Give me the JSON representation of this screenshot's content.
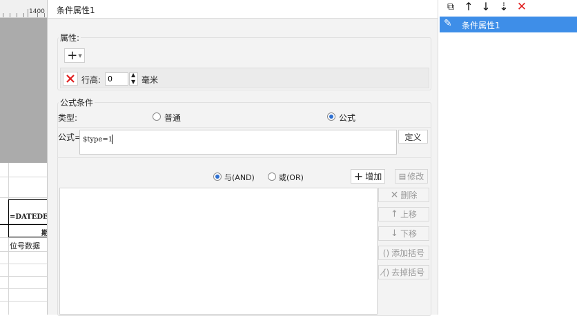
{
  "sheet": {
    "ruler_label": "1400",
    "cells": {
      "formula_cell": "=DATEDEI",
      "cell_2": "期",
      "cell_3": "位号数据"
    }
  },
  "dialog": {
    "title": "条件属性1",
    "properties": {
      "group_label": "属性:",
      "row_height_label": "行高:",
      "row_height_value": "0",
      "unit": "毫米"
    },
    "formula_condition": {
      "group_label": "公式条件",
      "type_label": "类型:",
      "type_options": [
        "普通",
        "公式"
      ],
      "selected_type": "公式",
      "formula_label": "公式=",
      "formula_value": "$type=1",
      "define_button": "定义",
      "logic_options": [
        "与(AND)",
        "或(OR)"
      ],
      "selected_logic": "与(AND)",
      "add_button": "增加",
      "modify_button": "修改",
      "side_buttons": {
        "delete": "删除",
        "move_up": "上移",
        "move_down": "下移",
        "add_bracket": "添加括号",
        "remove_bracket": "去掉括号"
      }
    }
  },
  "right_panel": {
    "toolbar_icons": [
      "copy-icon",
      "arrow-up-icon",
      "arrow-down-icon",
      "move-bottom-icon",
      "delete-icon"
    ],
    "list_items": [
      {
        "label": "条件属性1",
        "icon": "pencil-icon",
        "selected": true
      }
    ]
  },
  "colors": {
    "accent": "#3e8ee8",
    "delete_red": "#e02020",
    "radio_selected": "#2d6fd0"
  }
}
